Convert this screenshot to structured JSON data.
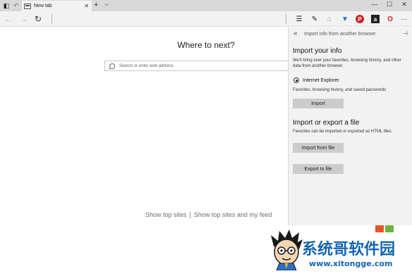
{
  "browser": {
    "tab_label": "New tab",
    "tab_close": "✕",
    "new_tab": "+",
    "tab_menu": "⌵",
    "window_controls": [
      "—",
      "☐",
      "✕"
    ]
  },
  "nav": {
    "back": "←",
    "forward": "→",
    "refresh": "↻",
    "tools": [
      {
        "name": "hub-icon",
        "glyph": "☰",
        "color": "#333333"
      },
      {
        "name": "web-note-icon",
        "glyph": "✎",
        "color": "#333333"
      },
      {
        "name": "share-icon",
        "glyph": "⌂",
        "color": "#9a9a9a"
      },
      {
        "name": "extension-blue-icon",
        "glyph": "▼",
        "color": "#1e6fc4"
      },
      {
        "name": "pinterest-icon",
        "glyph": "P",
        "color": "#c8232c"
      },
      {
        "name": "amazon-extension-icon",
        "glyph": "a",
        "color": "#ffffff"
      },
      {
        "name": "opera-extension-icon",
        "glyph": "O",
        "color": "#e02020"
      },
      {
        "name": "more-icon",
        "glyph": "···",
        "color": "#333333"
      }
    ]
  },
  "main": {
    "heading": "Where to next?",
    "search_placeholder": "Search or enter web address",
    "top_sites_link": "Show top sites",
    "separator": "|",
    "top_sites_feed_link": "Show top sites and my feed"
  },
  "panel": {
    "back": "«",
    "title": "Import info from another browser",
    "pin": "⊣",
    "import_heading": "Import your info",
    "import_desc": "We'll bring over your favorites, browsing history, and other data from another browser.",
    "browser_option": "Internet Explorer",
    "browser_option_desc": "Favorites, browsing history, and saved passwords",
    "import_button": "Import",
    "file_heading": "Import or export a file",
    "file_desc": "Favorites can be imported or exported as HTML files.",
    "import_file_button": "Import from file",
    "export_file_button": "Export to file"
  },
  "watermark": {
    "title": "系统哥软件园",
    "url": "www.xitongge.com"
  },
  "colors": {
    "accent": "#1565b0",
    "panel_bg": "#f2f2f2",
    "button_bg": "#cccccc"
  }
}
